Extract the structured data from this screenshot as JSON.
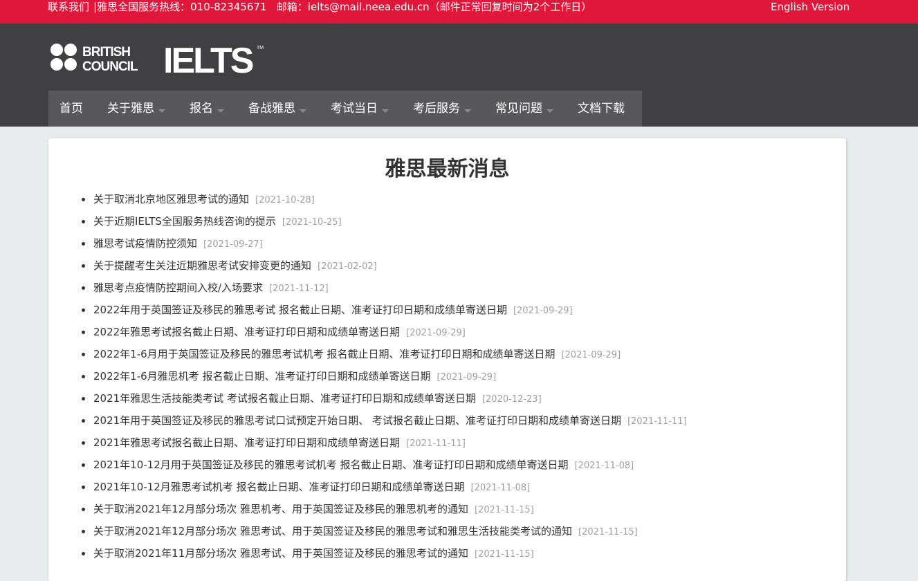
{
  "topbar": {
    "contact": "联系我们",
    "hotline": "雅思全国服务热线：010-82345671",
    "email": "邮箱：ielts@mail.neea.edu.cn（邮件正常回复时间为2个工作日）",
    "english_version": "English Version",
    "color": "#e0173a"
  },
  "header": {
    "logo_line1": "BRITISH",
    "logo_line2": "COUNCIL",
    "brand": "IELTS",
    "trademark": "TM",
    "background": "#404043"
  },
  "nav": [
    {
      "label": "首页",
      "has_dropdown": false
    },
    {
      "label": "关于雅思",
      "has_dropdown": true
    },
    {
      "label": "报名",
      "has_dropdown": true
    },
    {
      "label": "备战雅思",
      "has_dropdown": true
    },
    {
      "label": "考试当日",
      "has_dropdown": true
    },
    {
      "label": "考后服务",
      "has_dropdown": true
    },
    {
      "label": "常见问题",
      "has_dropdown": true
    },
    {
      "label": "文档下载",
      "has_dropdown": false
    }
  ],
  "main": {
    "title": "雅思最新消息",
    "news": [
      {
        "title": "关于取消北京地区雅思考试的通知",
        "date": "[2021-10-28]"
      },
      {
        "title": "关于近期IELTS全国服务热线咨询的提示",
        "date": "[2021-10-25]"
      },
      {
        "title": "雅思考试疫情防控须知",
        "date": "[2021-09-27]"
      },
      {
        "title": "关于提醒考生关注近期雅思考试安排变更的通知",
        "date": "[2021-02-02]"
      },
      {
        "title": "雅思考点疫情防控期间入校/入场要求",
        "date": "[2021-11-12]"
      },
      {
        "title": "2022年用于英国签证及移民的雅思考试 报名截止日期、准考证打印日期和成绩单寄送日期",
        "date": "[2021-09-29]"
      },
      {
        "title": "2022年雅思考试报名截止日期、准考证打印日期和成绩单寄送日期",
        "date": "[2021-09-29]"
      },
      {
        "title": "2022年1-6月用于英国签证及移民的雅思考试机考 报名截止日期、准考证打印日期和成绩单寄送日期",
        "date": "[2021-09-29]"
      },
      {
        "title": "2022年1-6月雅思机考 报名截止日期、准考证打印日期和成绩单寄送日期",
        "date": "[2021-09-29]"
      },
      {
        "title": "2021年雅思生活技能类考试 考试报名截止日期、准考证打印日期和成绩单寄送日期",
        "date": "[2020-12-23]"
      },
      {
        "title": "2021年用于英国签证及移民的雅思考试口试预定开始日期、 考试报名截止日期、准考证打印日期和成绩单寄送日期",
        "date": "[2021-11-11]"
      },
      {
        "title": "2021年雅思考试报名截止日期、准考证打印日期和成绩单寄送日期",
        "date": "[2021-11-11]"
      },
      {
        "title": "2021年10-12月用于英国签证及移民的雅思考试机考 报名截止日期、准考证打印日期和成绩单寄送日期",
        "date": "[2021-11-08]"
      },
      {
        "title": "2021年10-12月雅思考试机考 报名截止日期、准考证打印日期和成绩单寄送日期",
        "date": "[2021-11-08]"
      },
      {
        "title": "关于取消2021年12月部分场次 雅思机考、用于英国签证及移民的雅思机考的通知",
        "date": "[2021-11-15]"
      },
      {
        "title": "关于取消2021年12月部分场次 雅思考试、用于英国签证及移民的雅思考试和雅思生活技能类考试的通知",
        "date": "[2021-11-15]"
      },
      {
        "title": "关于取消2021年11月部分场次 雅思考试、用于英国签证及移民的雅思考试的通知",
        "date": "[2021-11-15]"
      }
    ]
  }
}
